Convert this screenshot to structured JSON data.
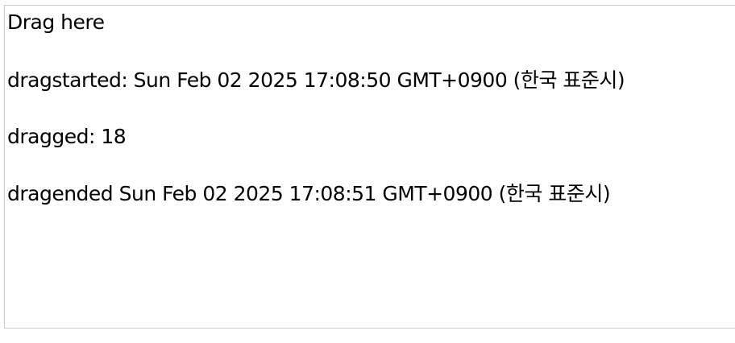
{
  "drag_area": {
    "title": "Drag here",
    "drag_started": "dragstarted: Sun Feb 02 2025 17:08:50 GMT+0900 (한국 표준시)",
    "dragged": "dragged: 18",
    "drag_ended": "dragended Sun Feb 02 2025 17:08:51 GMT+0900 (한국 표준시)"
  },
  "colors": {
    "border": "#c9c9c9",
    "text": "#000000",
    "background": "#ffffff"
  }
}
